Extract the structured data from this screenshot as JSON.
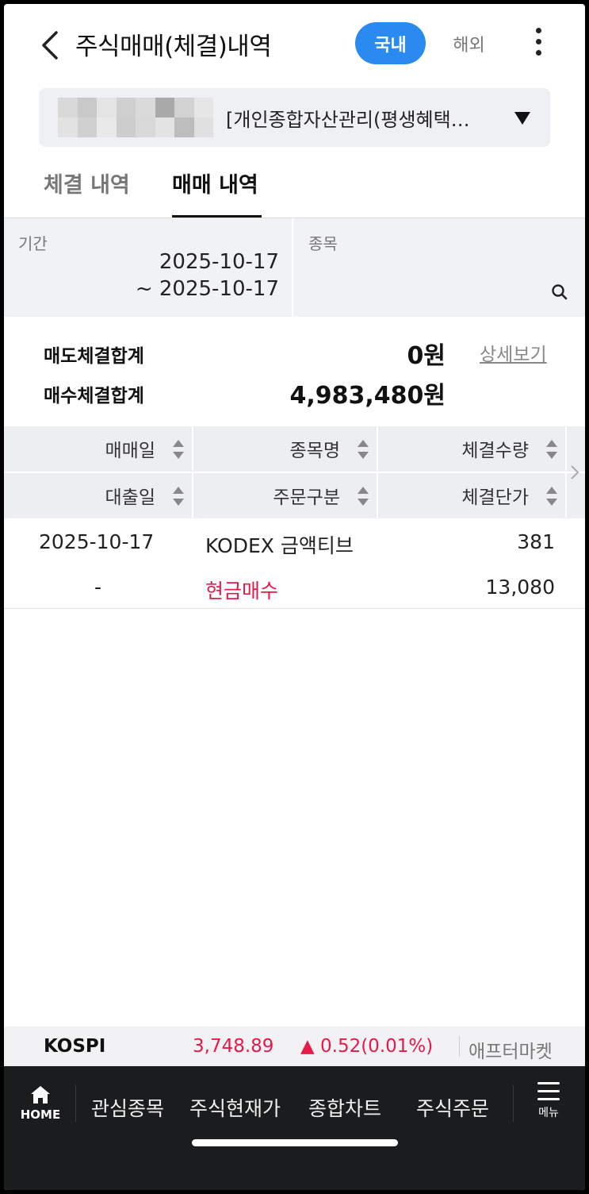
{
  "header": {
    "title": "주식매매(체결)내역",
    "seg_domestic": "국내",
    "seg_overseas": "해외"
  },
  "account": {
    "name": "[개인종합자산관리(평생혜택…"
  },
  "tabs": [
    {
      "label": "체결 내역",
      "active": false
    },
    {
      "label": "매매 내역",
      "active": true
    }
  ],
  "filter": {
    "period_label": "기간",
    "period_start": "2025-10-17",
    "period_end": "~ 2025-10-17",
    "stock_label": "종목"
  },
  "summary": {
    "sell_label": "매도체결합계",
    "sell_value": "0원",
    "buy_label": "매수체결합계",
    "buy_value": "4,983,480원",
    "detail_link": "상세보기"
  },
  "table": {
    "headers_row1": [
      "매매일",
      "종목명",
      "체결수량"
    ],
    "headers_row2": [
      "대출일",
      "주문구분",
      "체결단가"
    ],
    "rows": [
      {
        "trade_date": "2025-10-17",
        "stock_name": "KODEX 금액티브",
        "quantity": "381",
        "loan_date": "-",
        "order_type": "현금매수",
        "price": "13,080"
      }
    ]
  },
  "ticker": {
    "name": "KOSPI",
    "price": "3,748.89",
    "change": "▲ 0.52(0.01%)",
    "after_market": "애프터마켓"
  },
  "bottom_nav": {
    "home": "HOME",
    "items": [
      "관심종목",
      "주식현재가",
      "종합차트",
      "주식주문"
    ],
    "menu": "메뉴"
  },
  "colors": {
    "accent": "#2b8af0",
    "up_red": "#e5194a",
    "nav_bg": "#1b1c1e"
  }
}
